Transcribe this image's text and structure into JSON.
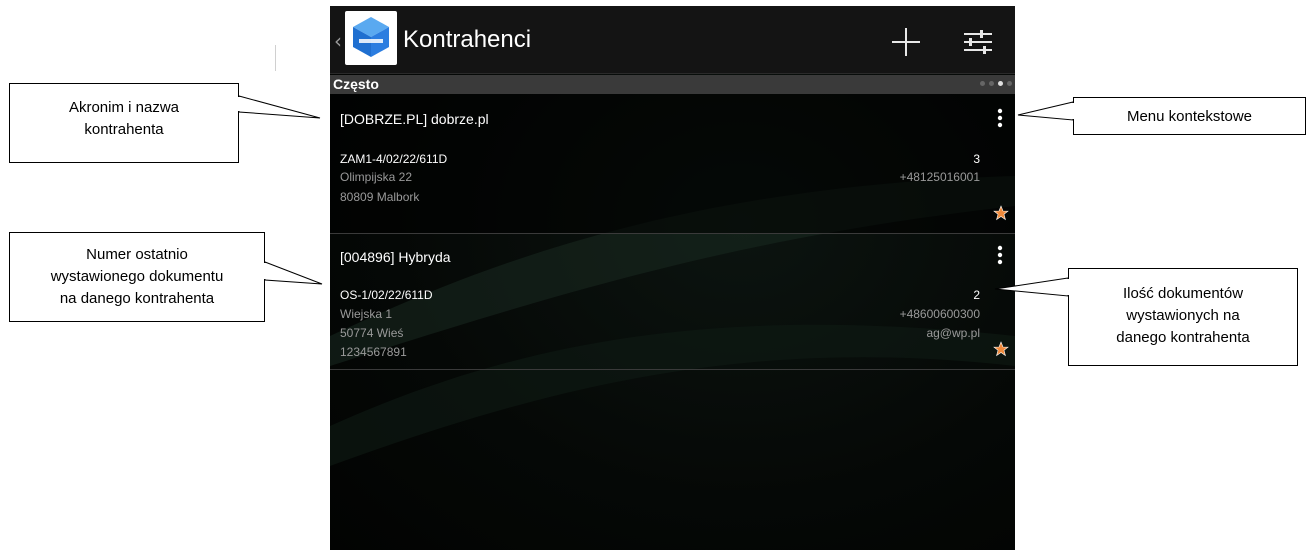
{
  "app": {
    "title": "Kontrahenci",
    "back_icon": "chevron-left-icon",
    "logo_icon": "app-logo-icon",
    "add_icon": "plus-icon",
    "filter_icon": "sliders-icon"
  },
  "section": {
    "label": "Często",
    "page_dots": 4,
    "active_dot": 3
  },
  "contractors": [
    {
      "name": "[DOBRZE.PL] dobrze.pl",
      "last_document": "ZAM1-4/02/22/611D",
      "street": "Olimpijska 22",
      "city": "80809 Malbork",
      "extra": "",
      "document_count": "3",
      "phone": "+48125016001",
      "email": "",
      "favorite": true
    },
    {
      "name": "[004896] Hybryda",
      "last_document": "OS-1/02/22/611D",
      "street": "Wiejska 1",
      "city": "50774 Wieś",
      "extra": "1234567891",
      "document_count": "2",
      "phone": "+48600600300",
      "email": "ag@wp.pl",
      "favorite": true
    }
  ],
  "callouts": {
    "acronym_name": [
      "Akronim i nazwa",
      "kontrahenta"
    ],
    "context_menu": [
      "Menu kontekstowe"
    ],
    "last_document": [
      "Numer ostatnio",
      "wystawionego dokumentu",
      "na danego kontrahenta"
    ],
    "document_count": [
      "Ilość dokumentów",
      "wystawionych na",
      "danego kontrahenta"
    ]
  },
  "colors": {
    "accent_star": "#f08a3c",
    "actionbar": "#141414",
    "section_bar": "#3a3a3a",
    "logo_blue": "#2b7de0"
  }
}
